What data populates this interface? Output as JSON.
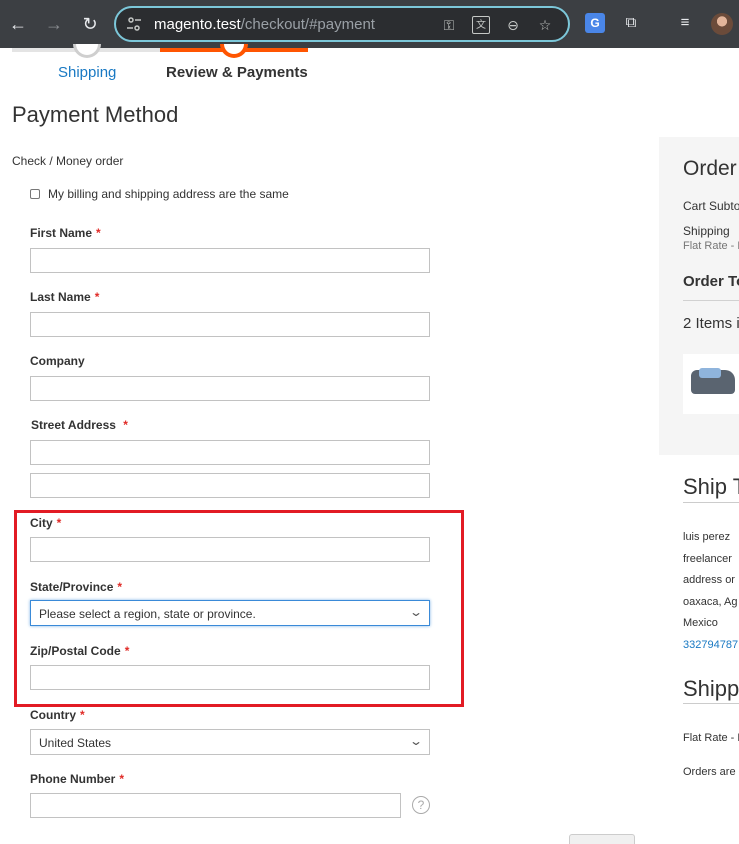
{
  "browser": {
    "url_host": "magento.test",
    "url_path": "/checkout/#payment",
    "icons": {
      "back": "back-arrow-icon",
      "forward": "forward-arrow-icon",
      "reload": "reload-icon",
      "site_settings": "tune-icon",
      "password": "key-icon",
      "translate": "translate-icon",
      "zoom": "zoom-out-icon",
      "bookmark": "star-icon",
      "extension_translate": "google-translate-icon",
      "extensions": "puzzle-icon",
      "media": "media-queue-icon",
      "profile": "avatar"
    }
  },
  "progress": {
    "steps": [
      {
        "label": "Shipping",
        "state": "complete"
      },
      {
        "label": "Review & Payments",
        "state": "active"
      }
    ],
    "accent": "#ff5501"
  },
  "payment": {
    "title": "Payment Method",
    "method_label": "Check / Money order",
    "same_address_label": "My billing and shipping address are the same"
  },
  "form": {
    "required_mark": "*",
    "first_name": {
      "label": "First Name",
      "value": ""
    },
    "last_name": {
      "label": "Last Name",
      "value": ""
    },
    "company": {
      "label": "Company",
      "value": ""
    },
    "street": {
      "label": "Street Address",
      "line1": "",
      "line2": ""
    },
    "city": {
      "label": "City",
      "value": ""
    },
    "region": {
      "label": "State/Province",
      "selected": "Please select a region, state or province."
    },
    "zip": {
      "label": "Zip/Postal Code",
      "value": ""
    },
    "country": {
      "label": "Country",
      "selected": "United States"
    },
    "phone": {
      "label": "Phone Number",
      "value": ""
    },
    "help_glyph": "?"
  },
  "summary": {
    "title": "Order",
    "cart_subtotal": "Cart Subto",
    "shipping": "Shipping",
    "shipping_sub": "Flat Rate - F",
    "order_total": "Order To",
    "items": "2 Items i"
  },
  "ship_to": {
    "title": "Ship T",
    "lines": [
      "luis perez",
      "freelancer",
      "address or",
      "oaxaca, Ag",
      "Mexico"
    ],
    "phone": "332794787"
  },
  "shipping_method": {
    "title": "Shippi",
    "method": "Flat Rate - F",
    "note": "Orders are"
  },
  "highlight_color": "#e21b24"
}
